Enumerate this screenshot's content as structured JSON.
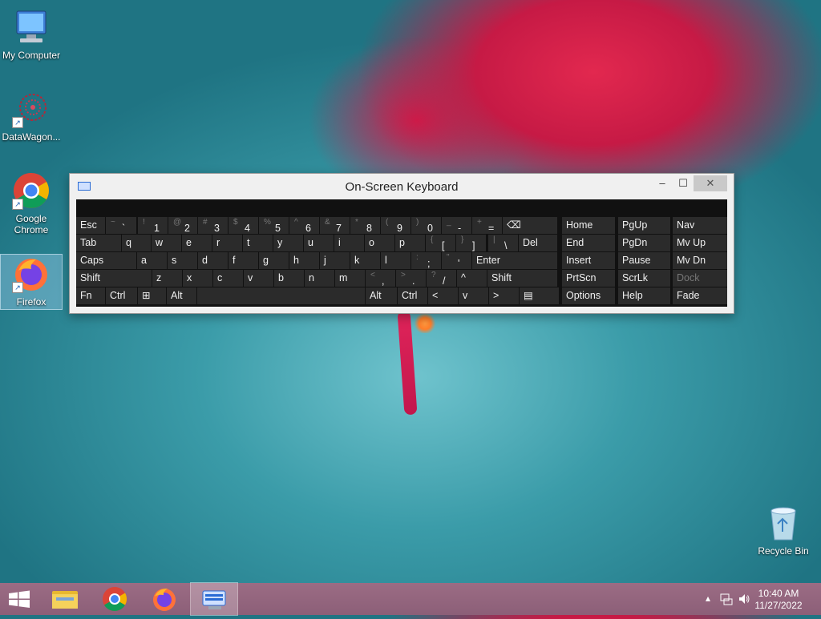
{
  "desktop": {
    "icons": [
      {
        "label": "My Computer"
      },
      {
        "label": "DataWagon..."
      },
      {
        "label": "Google Chrome"
      },
      {
        "label": "Firefox"
      }
    ],
    "recycle_bin": {
      "label": "Recycle Bin"
    }
  },
  "osk": {
    "title": "On-Screen Keyboard",
    "window_buttons": {
      "minimize": "–",
      "maximize": "☐",
      "close": "✕"
    },
    "rows": [
      [
        {
          "main": "Esc"
        },
        {
          "shift": "~",
          "main": "`"
        },
        {
          "shift": "!",
          "main": "1"
        },
        {
          "shift": "@",
          "main": "2"
        },
        {
          "shift": "#",
          "main": "3"
        },
        {
          "shift": "$",
          "main": "4"
        },
        {
          "shift": "%",
          "main": "5"
        },
        {
          "shift": "^",
          "main": "6"
        },
        {
          "shift": "&",
          "main": "7"
        },
        {
          "shift": "*",
          "main": "8"
        },
        {
          "shift": "(",
          "main": "9"
        },
        {
          "shift": ")",
          "main": "0"
        },
        {
          "shift": "_",
          "main": "-"
        },
        {
          "shift": "+",
          "main": "="
        },
        {
          "main": "⌫"
        }
      ],
      [
        {
          "main": "Tab"
        },
        {
          "main": "q"
        },
        {
          "main": "w"
        },
        {
          "main": "e"
        },
        {
          "main": "r"
        },
        {
          "main": "t"
        },
        {
          "main": "y"
        },
        {
          "main": "u"
        },
        {
          "main": "i"
        },
        {
          "main": "o"
        },
        {
          "main": "p"
        },
        {
          "shift": "{",
          "main": "["
        },
        {
          "shift": "}",
          "main": "]"
        },
        {
          "shift": "|",
          "main": "\\"
        },
        {
          "main": "Del"
        }
      ],
      [
        {
          "main": "Caps"
        },
        {
          "main": "a"
        },
        {
          "main": "s"
        },
        {
          "main": "d"
        },
        {
          "main": "f"
        },
        {
          "main": "g"
        },
        {
          "main": "h"
        },
        {
          "main": "j"
        },
        {
          "main": "k"
        },
        {
          "main": "l"
        },
        {
          "shift": ":",
          "main": ";"
        },
        {
          "shift": "\"",
          "main": "'"
        },
        {
          "main": "Enter"
        }
      ],
      [
        {
          "main": "Shift"
        },
        {
          "main": "z"
        },
        {
          "main": "x"
        },
        {
          "main": "c"
        },
        {
          "main": "v"
        },
        {
          "main": "b"
        },
        {
          "main": "n"
        },
        {
          "main": "m"
        },
        {
          "shift": "<",
          "main": ","
        },
        {
          "shift": ">",
          "main": "."
        },
        {
          "shift": "?",
          "main": "/"
        },
        {
          "main": "^"
        },
        {
          "main": "Shift"
        }
      ],
      [
        {
          "main": "Fn"
        },
        {
          "main": "Ctrl"
        },
        {
          "main": "⊞"
        },
        {
          "main": "Alt"
        },
        {
          "main": ""
        },
        {
          "main": "Alt"
        },
        {
          "main": "Ctrl"
        },
        {
          "main": "<"
        },
        {
          "main": "v"
        },
        {
          "main": ">"
        },
        {
          "main": "▤"
        }
      ]
    ],
    "nav_rows": [
      [
        "Home",
        "PgUp",
        "Nav"
      ],
      [
        "End",
        "PgDn",
        "Mv Up"
      ],
      [
        "Insert",
        "Pause",
        "Mv Dn"
      ],
      [
        "PrtScn",
        "ScrLk",
        "Dock"
      ],
      [
        "Options",
        "Help",
        "Fade"
      ]
    ]
  },
  "taskbar": {
    "clock_time": "10:40 AM",
    "clock_date": "11/27/2022",
    "tray_icons": [
      "chevron-up-icon",
      "network-icon",
      "volume-icon"
    ]
  }
}
